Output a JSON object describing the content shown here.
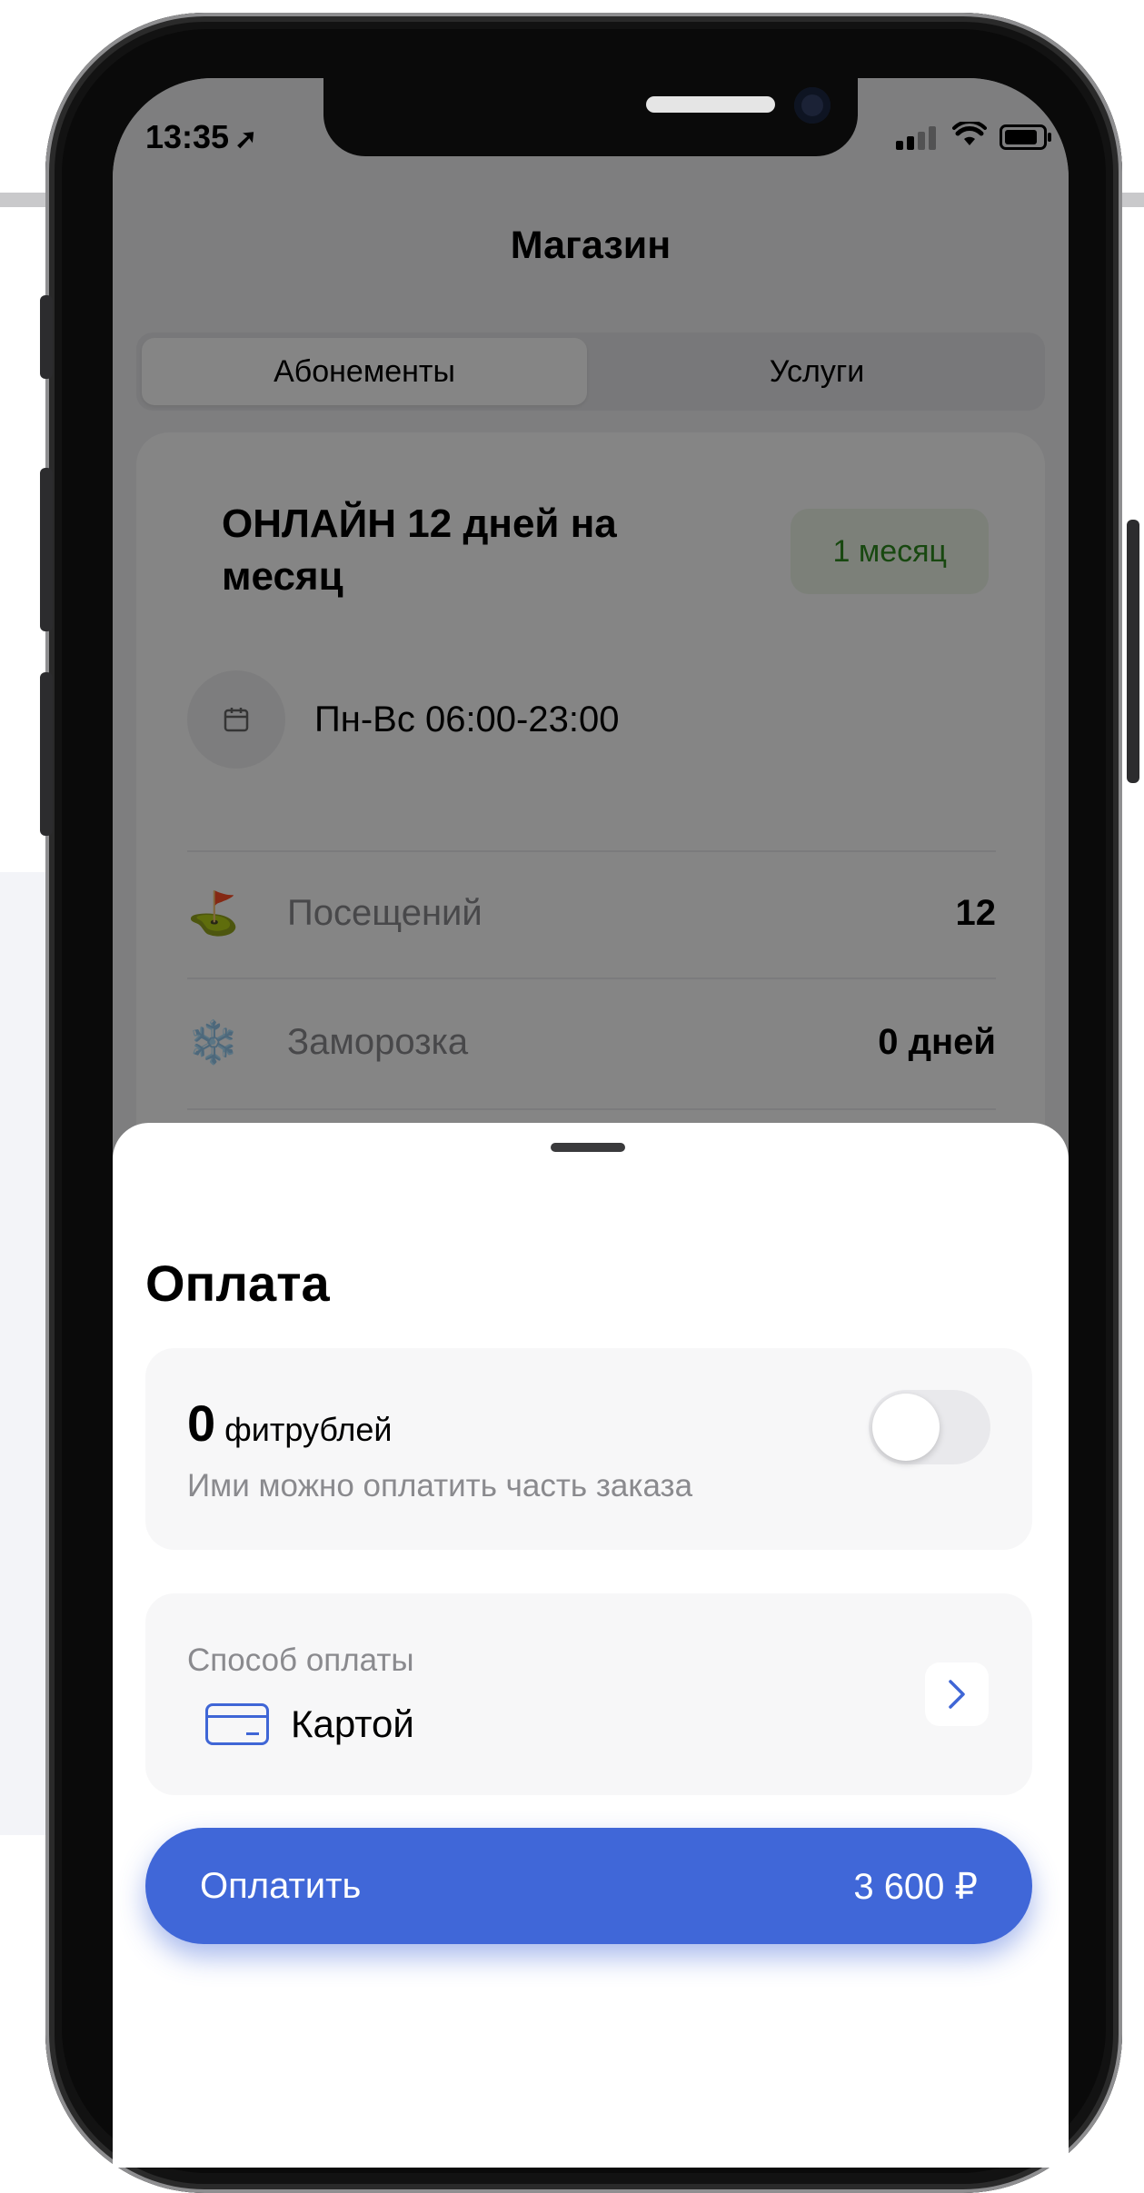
{
  "status_bar": {
    "time": "13:35"
  },
  "page": {
    "title": "Магазин"
  },
  "segments": {
    "active": "Абонементы",
    "inactive": "Услуги"
  },
  "membership": {
    "title": "ОНЛАЙН 12 дней на месяц",
    "badge": "1 месяц",
    "schedule": "Пн-Вс 06:00-23:00",
    "rows": [
      {
        "label": "Посещений",
        "value": "12",
        "icon": "golf-flag-icon"
      },
      {
        "label": "Заморозка",
        "value": "0 дней",
        "icon": "snowflake-icon"
      }
    ]
  },
  "payment_sheet": {
    "title": "Оплата",
    "points": {
      "amount": "0",
      "unit": "фитрублей",
      "hint": "Ими можно оплатить часть заказа",
      "toggle_on": false
    },
    "method": {
      "label": "Способ оплаты",
      "value": "Картой"
    },
    "pay_button": {
      "label": "Оплатить",
      "amount": "3 600 ₽"
    }
  },
  "colors": {
    "accent": "#4067d8",
    "badge_text": "#2e8a20",
    "badge_bg": "#edf6e8"
  }
}
